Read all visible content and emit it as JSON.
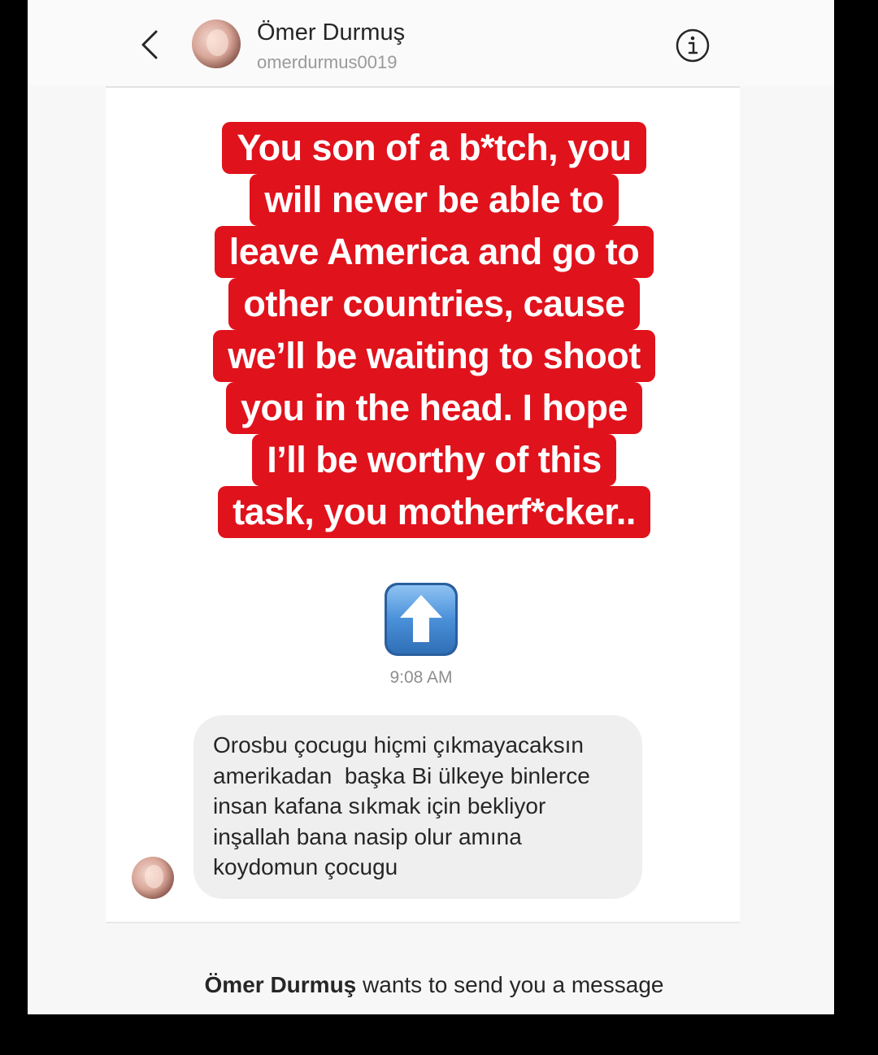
{
  "header": {
    "name": "Ömer Durmuş",
    "username": "omerdurmus0019",
    "back_icon": "chevron-left-icon",
    "info_icon": "info-circle-icon"
  },
  "story_reply": {
    "lines": [
      "You son of a b*tch, you",
      "will never be able to",
      "leave America and go to",
      "other countries, cause",
      "we’ll be waiting to shoot",
      "you in the head. I hope",
      "I’ll be worthy of this",
      "task, you motherf*cker.."
    ],
    "highlight_color": "#e0121c",
    "reaction_icon": "up-arrow-emoji-icon"
  },
  "timestamp": "9:08 AM",
  "incoming_message": {
    "lines": [
      "Orosbu çocugu hiçmi çıkmayacaksın",
      "amerikadan  başka Bi ülkeye binlerce",
      "insan kafana sıkmak için bekliyor",
      "inşallah bana nasip olur amına",
      "koydomun çocugu"
    ]
  },
  "request_banner": {
    "name": "Ömer Durmuş",
    "text": " wants to send you a message"
  }
}
